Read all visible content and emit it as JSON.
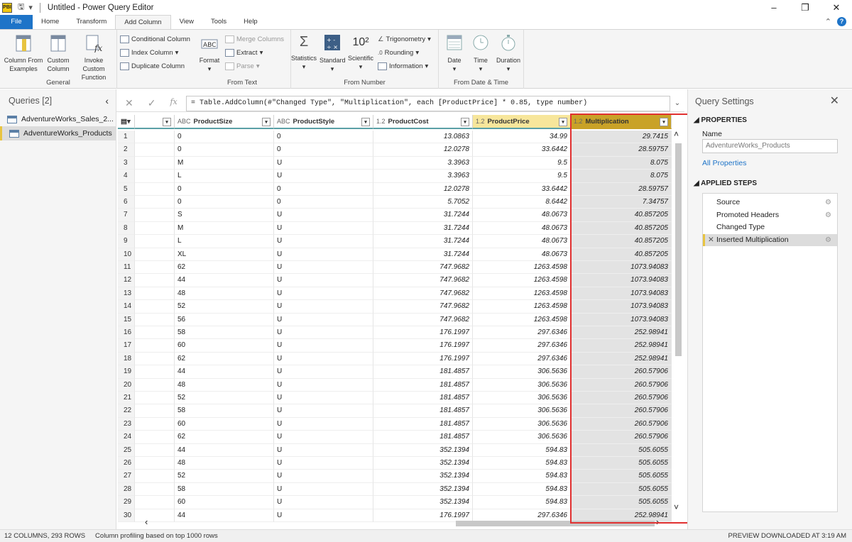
{
  "window": {
    "title": "Untitled - Power Query Editor",
    "app_logo": "PBI"
  },
  "tabs": [
    "File",
    "Home",
    "Transform",
    "Add Column",
    "View",
    "Tools",
    "Help"
  ],
  "active_tab": "Add Column",
  "ribbon": {
    "general": {
      "label": "General",
      "col_from_examples": "Column From Examples",
      "custom_column": "Custom Column",
      "invoke_custom_function": "Invoke Custom Function",
      "conditional_column": "Conditional Column",
      "index_column": "Index Column",
      "duplicate_column": "Duplicate Column"
    },
    "from_text": {
      "label": "From Text",
      "format": "Format",
      "merge_columns": "Merge Columns",
      "extract": "Extract",
      "parse": "Parse"
    },
    "from_number": {
      "label": "From Number",
      "statistics": "Statistics",
      "standard": "Standard",
      "scientific": "Scientific",
      "trigonometry": "Trigonometry",
      "rounding": "Rounding",
      "information": "Information"
    },
    "from_datetime": {
      "label": "From Date & Time",
      "date": "Date",
      "time": "Time",
      "duration": "Duration"
    }
  },
  "queries": {
    "header": "Queries [2]",
    "items": [
      "AdventureWorks_Sales_2...",
      "AdventureWorks_Products"
    ]
  },
  "formula": "= Table.AddColumn(#\"Changed Type\", \"Multiplication\", each [ProductPrice] * 0.85, type number)",
  "columns": [
    {
      "type": "",
      "name": ""
    },
    {
      "type": "ABC",
      "name": "ProductSize"
    },
    {
      "type": "ABC",
      "name": "ProductStyle"
    },
    {
      "type": "1.2",
      "name": "ProductCost"
    },
    {
      "type": "1.2",
      "name": "ProductPrice"
    },
    {
      "type": "1.2",
      "name": "Multiplication"
    }
  ],
  "rows": [
    [
      "1",
      "",
      "0",
      "0",
      "13.0863",
      "34.99",
      "29.7415"
    ],
    [
      "2",
      "",
      "0",
      "0",
      "12.0278",
      "33.6442",
      "28.59757"
    ],
    [
      "3",
      "",
      "M",
      "U",
      "3.3963",
      "9.5",
      "8.075"
    ],
    [
      "4",
      "",
      "L",
      "U",
      "3.3963",
      "9.5",
      "8.075"
    ],
    [
      "5",
      "",
      "0",
      "0",
      "12.0278",
      "33.6442",
      "28.59757"
    ],
    [
      "6",
      "",
      "0",
      "0",
      "5.7052",
      "8.6442",
      "7.34757"
    ],
    [
      "7",
      "",
      "S",
      "U",
      "31.7244",
      "48.0673",
      "40.857205"
    ],
    [
      "8",
      "",
      "M",
      "U",
      "31.7244",
      "48.0673",
      "40.857205"
    ],
    [
      "9",
      "",
      "L",
      "U",
      "31.7244",
      "48.0673",
      "40.857205"
    ],
    [
      "10",
      "",
      "XL",
      "U",
      "31.7244",
      "48.0673",
      "40.857205"
    ],
    [
      "11",
      "",
      "62",
      "U",
      "747.9682",
      "1263.4598",
      "1073.94083"
    ],
    [
      "12",
      "",
      "44",
      "U",
      "747.9682",
      "1263.4598",
      "1073.94083"
    ],
    [
      "13",
      "",
      "48",
      "U",
      "747.9682",
      "1263.4598",
      "1073.94083"
    ],
    [
      "14",
      "",
      "52",
      "U",
      "747.9682",
      "1263.4598",
      "1073.94083"
    ],
    [
      "15",
      "",
      "56",
      "U",
      "747.9682",
      "1263.4598",
      "1073.94083"
    ],
    [
      "16",
      "",
      "58",
      "U",
      "176.1997",
      "297.6346",
      "252.98941"
    ],
    [
      "17",
      "",
      "60",
      "U",
      "176.1997",
      "297.6346",
      "252.98941"
    ],
    [
      "18",
      "",
      "62",
      "U",
      "176.1997",
      "297.6346",
      "252.98941"
    ],
    [
      "19",
      "",
      "44",
      "U",
      "181.4857",
      "306.5636",
      "260.57906"
    ],
    [
      "20",
      "",
      "48",
      "U",
      "181.4857",
      "306.5636",
      "260.57906"
    ],
    [
      "21",
      "",
      "52",
      "U",
      "181.4857",
      "306.5636",
      "260.57906"
    ],
    [
      "22",
      "",
      "58",
      "U",
      "181.4857",
      "306.5636",
      "260.57906"
    ],
    [
      "23",
      "",
      "60",
      "U",
      "181.4857",
      "306.5636",
      "260.57906"
    ],
    [
      "24",
      "",
      "62",
      "U",
      "181.4857",
      "306.5636",
      "260.57906"
    ],
    [
      "25",
      "",
      "44",
      "U",
      "352.1394",
      "594.83",
      "505.6055"
    ],
    [
      "26",
      "",
      "48",
      "U",
      "352.1394",
      "594.83",
      "505.6055"
    ],
    [
      "27",
      "",
      "52",
      "U",
      "352.1394",
      "594.83",
      "505.6055"
    ],
    [
      "28",
      "",
      "58",
      "U",
      "352.1394",
      "594.83",
      "505.6055"
    ],
    [
      "29",
      "",
      "60",
      "U",
      "352.1394",
      "594.83",
      "505.6055"
    ],
    [
      "30",
      "",
      "44",
      "U",
      "176.1997",
      "297.6346",
      "252.98941"
    ]
  ],
  "query_settings": {
    "title": "Query Settings",
    "properties_label": "PROPERTIES",
    "name_label": "Name",
    "name_value": "AdventureWorks_Products",
    "all_properties": "All Properties",
    "applied_steps_label": "APPLIED STEPS",
    "steps": [
      "Source",
      "Promoted Headers",
      "Changed Type",
      "Inserted Multiplication"
    ]
  },
  "status": {
    "left": "12 COLUMNS, 293 ROWS",
    "profiling": "Column profiling based on top 1000 rows",
    "right": "PREVIEW DOWNLOADED AT 3:19 AM"
  },
  "colors": {
    "accent": "#1e74c8",
    "highlight": "#c9a227",
    "red_box": "#e03030"
  }
}
